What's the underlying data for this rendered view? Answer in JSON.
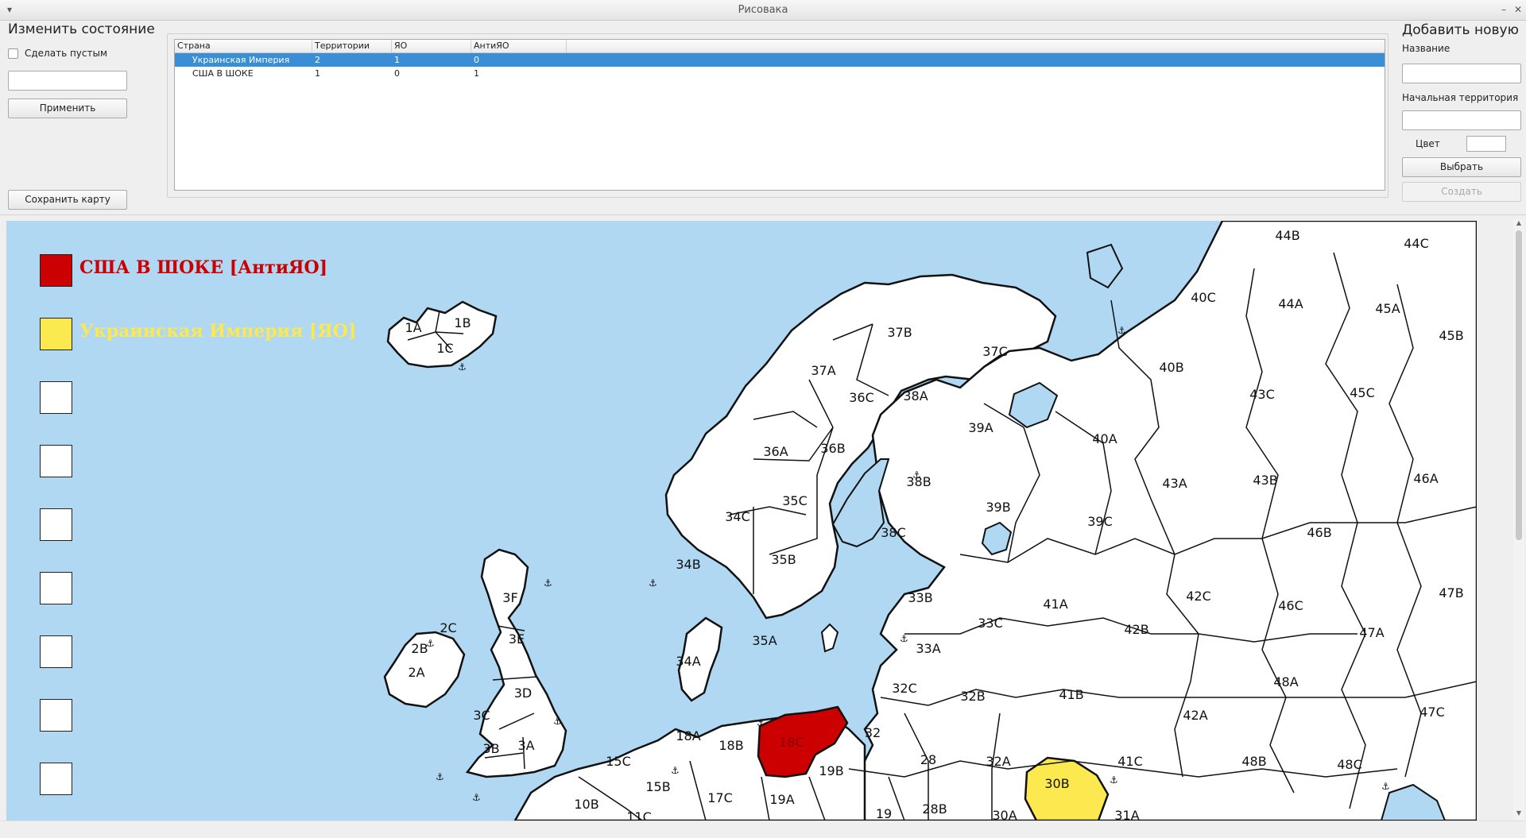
{
  "window": {
    "title": "Рисовака"
  },
  "left_panel": {
    "title": "Изменить состояние",
    "checkbox_label": "Сделать пустым",
    "input_value": "",
    "apply_label": "Применить",
    "save_map_label": "Сохранить карту"
  },
  "table": {
    "headers": [
      "Страна",
      "Территории",
      "ЯО",
      "АнтиЯО"
    ],
    "rows": [
      {
        "country": "Украинская Империя",
        "territories": "2",
        "yo": "1",
        "antiyo": "0",
        "selected": true
      },
      {
        "country": "США В ШОКЕ",
        "territories": "1",
        "yo": "0",
        "antiyo": "1",
        "selected": false
      }
    ]
  },
  "right_panel": {
    "title": "Добавить новую",
    "name_label": "Название",
    "name_value": "",
    "start_territory_label": "Начальная территория",
    "start_territory_value": "",
    "color_label": "Цвет",
    "choose_label": "Выбрать",
    "create_label": "Создать"
  },
  "map": {
    "colors": {
      "sea": "#b0d8f2",
      "land": "#ffffff",
      "border": "#111111",
      "usa": "#cc0000",
      "ukraine": "#fce94f"
    },
    "legend": [
      {
        "label": "США В ШОКЕ [АнтиЯО]",
        "color": "#cc0000"
      },
      {
        "label": "Украинская Империя [ЯО]",
        "color": "#fce94f"
      },
      {
        "label": "",
        "color": "#ffffff"
      },
      {
        "label": "",
        "color": "#ffffff"
      },
      {
        "label": "",
        "color": "#ffffff"
      },
      {
        "label": "",
        "color": "#ffffff"
      },
      {
        "label": "",
        "color": "#ffffff"
      },
      {
        "label": "",
        "color": "#ffffff"
      },
      {
        "label": "",
        "color": "#ffffff"
      }
    ],
    "territory_labels": [
      "44B",
      "44C",
      "40C",
      "44A",
      "45A",
      "45B",
      "1A",
      "1B",
      "1C",
      "37B",
      "37C",
      "40B",
      "43C",
      "45C",
      "37A",
      "36C",
      "38A",
      "39A",
      "40A",
      "36A",
      "36B",
      "46A",
      "38B",
      "39B",
      "43A",
      "43B",
      "35C",
      "34C",
      "39C",
      "38C",
      "46B",
      "34B",
      "35B",
      "3F",
      "33B",
      "41A",
      "42C",
      "46C",
      "47B",
      "2C",
      "33C",
      "42B",
      "47A",
      "3E",
      "2B",
      "35A",
      "33A",
      "34A",
      "2A",
      "3D",
      "32C",
      "32B",
      "41B",
      "48A",
      "42A",
      "47C",
      "3C",
      "18A",
      "18C",
      "32",
      "18B",
      "3B",
      "3A",
      "19B",
      "28",
      "32A",
      "41C",
      "48B",
      "48C",
      "15C",
      "30B",
      "15B",
      "17C",
      "19A",
      "10B",
      "28B",
      "30A",
      "31A",
      "19",
      "11C"
    ],
    "filled_territories": [
      {
        "label": "18C",
        "owner": "США В ШОКЕ"
      },
      {
        "label": "30B",
        "owner": "Украинская Империя"
      }
    ],
    "anchor_icon": "anchor-icon"
  }
}
